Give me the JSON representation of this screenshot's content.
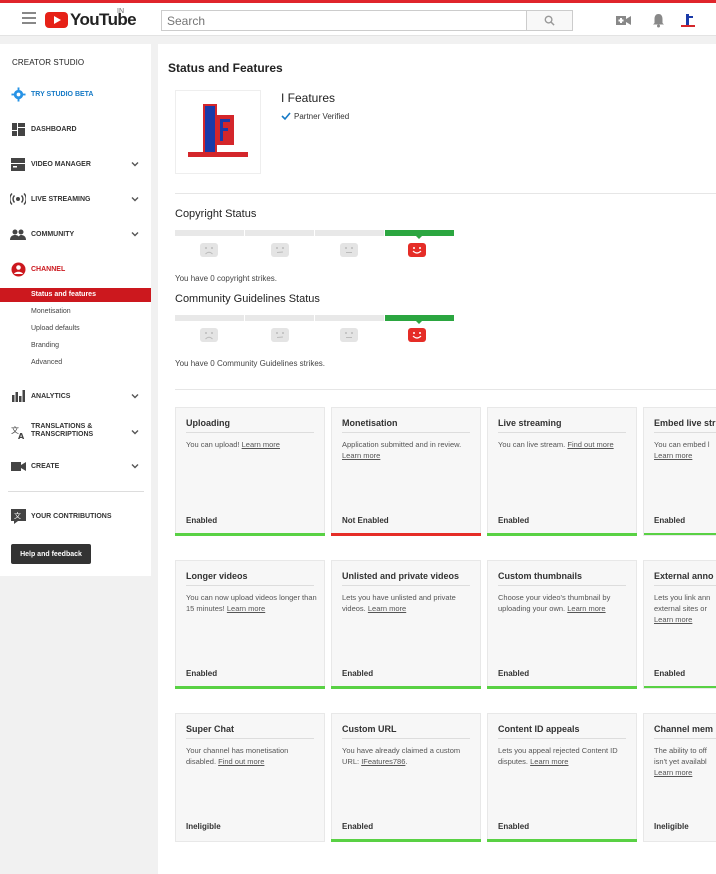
{
  "masthead": {
    "logo_text": "YouTube",
    "country_code": "IN",
    "search_placeholder": "Search"
  },
  "sidebar": {
    "title": "CREATOR STUDIO",
    "items": [
      {
        "label": "TRY STUDIO BETA",
        "icon": "gear-icon"
      },
      {
        "label": "DASHBOARD",
        "icon": "dashboard-icon"
      },
      {
        "label": "VIDEO MANAGER",
        "icon": "video-manager-icon"
      },
      {
        "label": "LIVE STREAMING",
        "icon": "live-icon"
      },
      {
        "label": "COMMUNITY",
        "icon": "community-icon"
      },
      {
        "label": "CHANNEL",
        "icon": "channel-icon"
      },
      {
        "label": "ANALYTICS",
        "icon": "analytics-icon"
      },
      {
        "label": "TRANSLATIONS &",
        "label2": "TRANSCRIPTIONS",
        "icon": "translate-icon"
      },
      {
        "label": "CREATE",
        "icon": "camera-icon"
      },
      {
        "label": "YOUR CONTRIBUTIONS",
        "icon": "contributions-icon"
      }
    ],
    "channel_sub": [
      "Status and features",
      "Monetisation",
      "Upload defaults",
      "Branding",
      "Advanced"
    ],
    "help_label": "Help and feedback"
  },
  "main": {
    "page_title": "Status and Features",
    "channel_name": "I Features",
    "verified_label": "Partner Verified",
    "copyright_title": "Copyright Status",
    "copyright_text": "You have 0 copyright strikes.",
    "community_title": "Community Guidelines Status",
    "community_text": "You have 0 Community Guidelines strikes."
  },
  "cards": [
    {
      "title": "Uploading",
      "desc": "You can upload!",
      "link": "Learn more",
      "status": "Enabled"
    },
    {
      "title": "Monetisation",
      "desc": "Application submitted and in review.",
      "link": "Learn more",
      "status": "Not Enabled"
    },
    {
      "title": "Live streaming",
      "desc": "You can live stream.",
      "link": "Find out more",
      "status": "Enabled"
    },
    {
      "title": "Embed live str",
      "desc": "You can embed l",
      "link": "Learn more",
      "status": "Enabled"
    },
    {
      "title": "Longer videos",
      "desc": "You can now upload videos longer than 15 minutes!",
      "link": "Learn more",
      "status": "Enabled"
    },
    {
      "title": "Unlisted and private videos",
      "desc": "Lets you have unlisted and private videos.",
      "link": "Learn more",
      "status": "Enabled"
    },
    {
      "title": "Custom thumbnails",
      "desc": "Choose your video's thumbnail by uploading your own.",
      "link": "Learn more",
      "status": "Enabled"
    },
    {
      "title": "External anno",
      "desc": "Lets you link ann external sites or",
      "link": "Learn more",
      "status": "Enabled"
    },
    {
      "title": "Super Chat",
      "desc": "Your channel has monetisation disabled.",
      "link": "Find out more",
      "status": "Ineligible"
    },
    {
      "title": "Custom URL",
      "desc": "You have already claimed a custom URL:",
      "link": "IFeatures786",
      "status": "Enabled"
    },
    {
      "title": "Content ID appeals",
      "desc": "Lets you appeal rejected Content ID disputes.",
      "link": "Learn more",
      "status": "Enabled"
    },
    {
      "title": "Channel mem",
      "desc": "The ability to off isn't yet availabl",
      "link": "Learn more",
      "status": "Ineligible"
    }
  ]
}
